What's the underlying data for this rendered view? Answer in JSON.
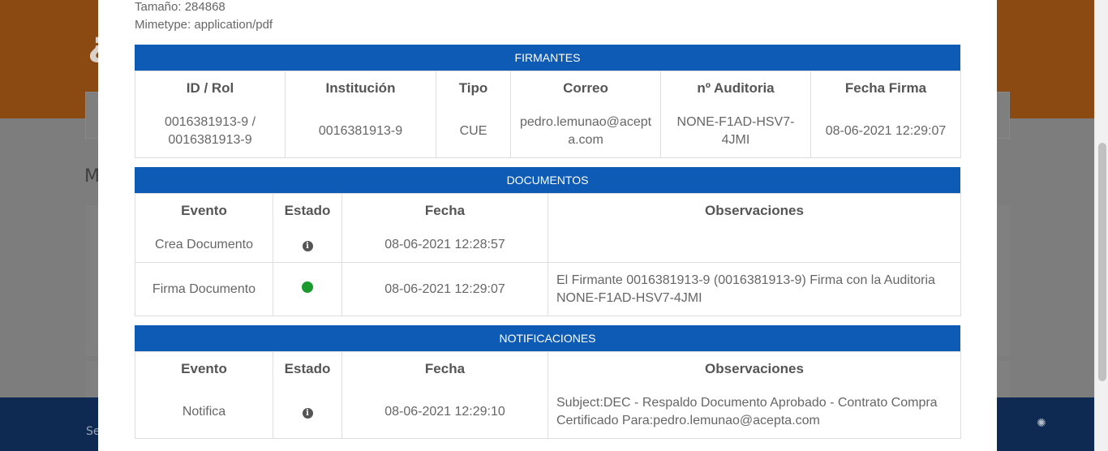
{
  "file": {
    "size_line": "Tamaño: 284868",
    "mimetype_line": "Mimetype: application/pdf"
  },
  "firmantes": {
    "title": "FIRMANTES",
    "headers": [
      "ID / Rol",
      "Institución",
      "Tipo",
      "Correo",
      "nº Auditoria",
      "Fecha Firma"
    ],
    "rows": [
      [
        "0016381913-9 / 0016381913-9",
        "0016381913-9",
        "CUE",
        "pedro.lemunao@acepta.com",
        "NONE-F1AD-HSV7-4JMI",
        "08-06-2021 12:29:07"
      ]
    ]
  },
  "documentos": {
    "title": "DOCUMENTOS",
    "headers": [
      "Evento",
      "Estado",
      "Fecha",
      "Observaciones"
    ],
    "rows": [
      {
        "evento": "Crea Documento",
        "estado_icon": "info-icon",
        "fecha": "08-06-2021 12:28:57",
        "obs": ""
      },
      {
        "evento": "Firma Documento",
        "estado_icon": "green-dot-icon",
        "fecha": "08-06-2021 12:29:07",
        "obs": "El Firmante 0016381913-9 (0016381913-9) Firma con la Auditoria NONE-F1AD-HSV7-4JMI"
      }
    ]
  },
  "notificaciones": {
    "title": "NOTIFICACIONES",
    "headers": [
      "Evento",
      "Estado",
      "Fecha",
      "Observaciones"
    ],
    "rows": [
      {
        "evento": "Notifica",
        "estado_icon": "info-icon",
        "fecha": "08-06-2021 12:29:10",
        "obs": "Subject:DEC - Respaldo Documento Aprobado - Contrato Compra Certificado Para:pedro.lemunao@acepta.com"
      }
    ]
  },
  "background": {
    "logo_glyph": "¿",
    "side_letter": "M",
    "footer_text": "Se",
    "spinner_glyph": "✺"
  },
  "colors": {
    "section_header": "#0d5bb5",
    "status_ok": "#1b9a2f"
  }
}
